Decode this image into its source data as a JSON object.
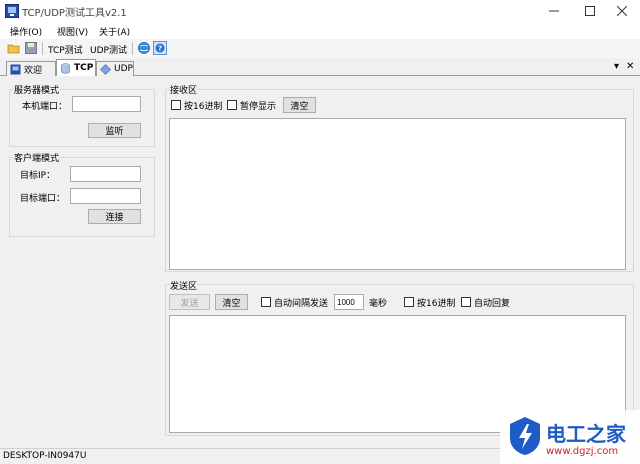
{
  "window": {
    "title": "TCP/UDP测试工具v2.1"
  },
  "menu": [
    "操作(O)",
    "视图(V)",
    "关于(A)"
  ],
  "toolbar": {
    "tcp_label": "TCP测试",
    "udp_label": "UDP测试"
  },
  "tabs": [
    {
      "label": "欢迎"
    },
    {
      "label": "TCP"
    },
    {
      "label": "UDP"
    }
  ],
  "server": {
    "group_label": "服务器模式",
    "port_label": "本机端口：",
    "port_value": "",
    "listen_button": "监听"
  },
  "client": {
    "group_label": "客户端模式",
    "ip_label": "目标IP：",
    "ip_value": "",
    "port_label": "目标端口：",
    "port_value": "",
    "connect_button": "连接"
  },
  "receive": {
    "group_label": "接收区",
    "hex_label": "按16进制",
    "pause_label": "暂停显示",
    "clear_button": "清空",
    "content": ""
  },
  "send": {
    "group_label": "发送区",
    "send_button": "发送",
    "clear_button": "清空",
    "auto_interval_label": "自动间隔发送",
    "interval_value": "1000",
    "ms_label": "毫秒",
    "hex_label": "按16进制",
    "auto_reply_label": "自动回复",
    "content": ""
  },
  "status": {
    "host": "DESKTOP-IN0947U"
  },
  "watermark": {
    "title": "电工之家",
    "url": "www.dgzj.com"
  },
  "colors": {
    "accent_blue": "#1e5bc6",
    "watermark_red": "#d11f1f"
  }
}
